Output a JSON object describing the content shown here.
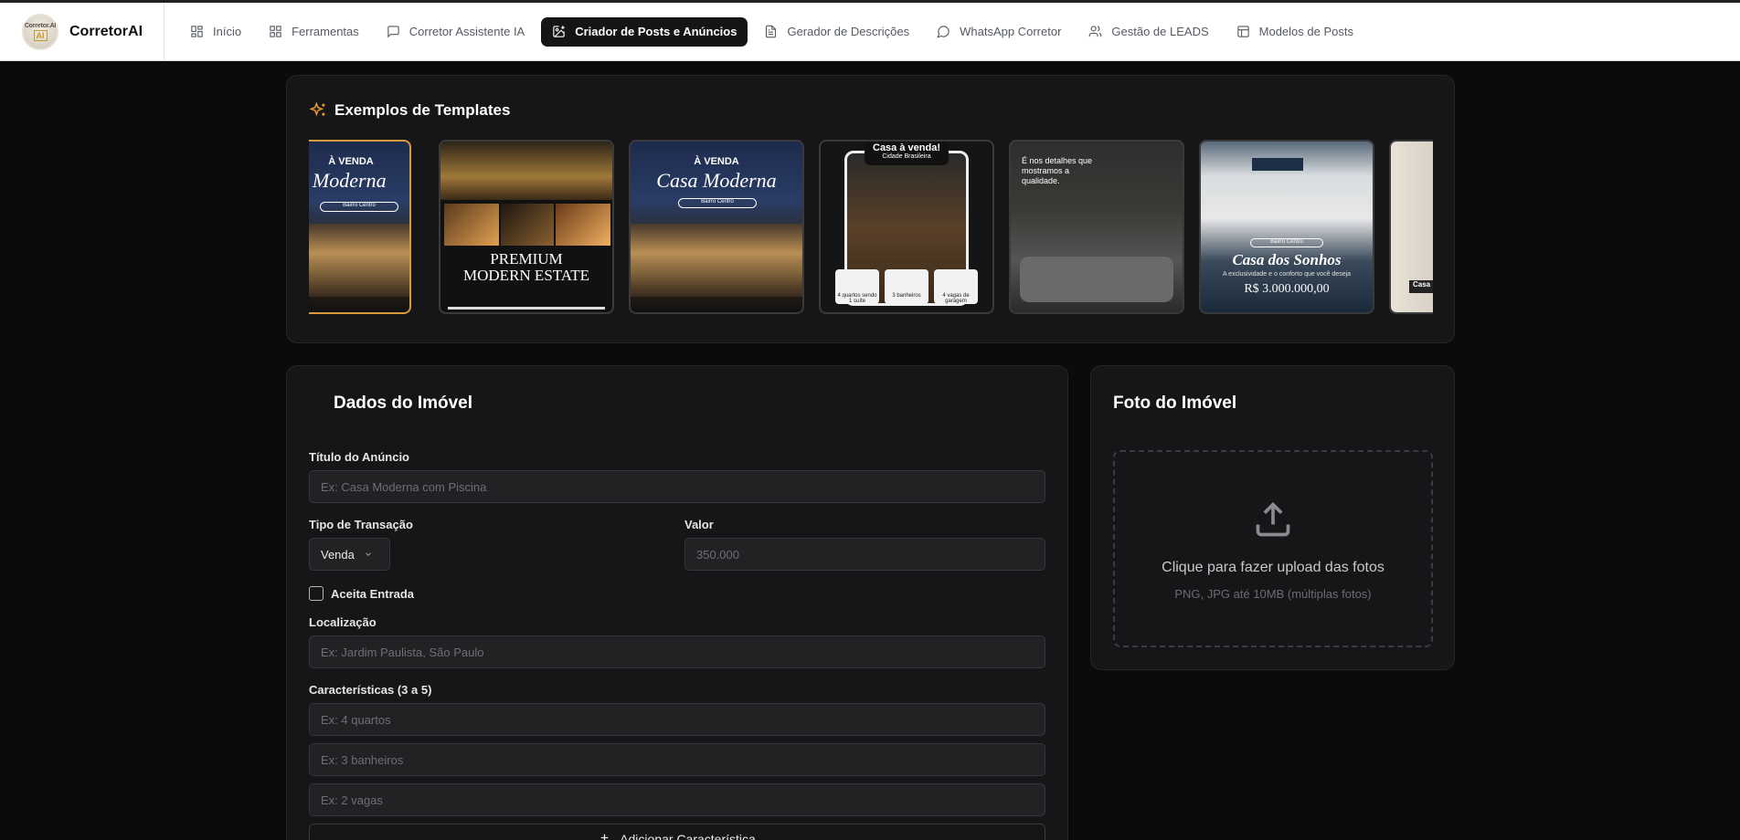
{
  "brand": {
    "name": "CorretorAI",
    "logo_line1": "Corretor.AI",
    "logo_line2": "AI"
  },
  "nav": [
    {
      "label": "Início",
      "icon": "grid-icon"
    },
    {
      "label": "Ferramentas",
      "icon": "grid-icon"
    },
    {
      "label": "Corretor Assistente IA",
      "icon": "chat-icon"
    },
    {
      "label": "Criador de Posts e Anúncios",
      "icon": "image-plus-icon",
      "active": true
    },
    {
      "label": "Gerador de Descrições",
      "icon": "document-icon"
    },
    {
      "label": "WhatsApp Corretor",
      "icon": "whatsapp-icon"
    },
    {
      "label": "Gestão de LEADS",
      "icon": "users-icon"
    },
    {
      "label": "Modelos de Posts",
      "icon": "layout-icon"
    }
  ],
  "templates": {
    "title": "Exemplos de Templates",
    "items": [
      {
        "top": "À VENDA",
        "main": "a Moderna",
        "badge": "Bairro Centro"
      },
      {
        "main": "PREMIUM MODERN ESTATE"
      },
      {
        "top": "À VENDA",
        "main": "Casa Moderna",
        "badge": "Bairro Centro"
      },
      {
        "top": "Casa à venda!",
        "sub": "Cidade Brasileira",
        "features": [
          "4 quartos sendo 1 suíte",
          "3 banheiros",
          "4 vagas de garagem"
        ]
      },
      {
        "main": "É nos detalhes que mostramos a qualidade."
      },
      {
        "main": "Casa dos Sonhos",
        "badge": "Bairro Centro",
        "sub": "A exclusividade e o conforto que você deseja",
        "price": "R$ 3.000.000,00"
      },
      {
        "main": "Casa"
      }
    ]
  },
  "form": {
    "title": "Dados do Imóvel",
    "titulo_label": "Título do Anúncio",
    "titulo_placeholder": "Ex: Casa Moderna com Piscina",
    "transacao_label": "Tipo de Transação",
    "transacao_value": "Venda",
    "valor_label": "Valor",
    "valor_placeholder": "350.000",
    "aceita_entrada_label": "Aceita Entrada",
    "aceita_entrada_checked": false,
    "localizacao_label": "Localização",
    "localizacao_placeholder": "Ex: Jardim Paulista, São Paulo",
    "caracteristicas_label": "Características (3 a 5)",
    "caracteristicas_placeholders": [
      "Ex: 4 quartos",
      "Ex: 3 banheiros",
      "Ex: 2 vagas"
    ],
    "add_label": "Adicionar Característica"
  },
  "photo": {
    "title": "Foto do Imóvel",
    "upload_main": "Clique para fazer upload das fotos",
    "upload_sub": "PNG, JPG até 10MB (múltiplas fotos)"
  },
  "colors": {
    "accent": "#d99a3a",
    "background": "#0b0b0c",
    "card": "#161618"
  }
}
